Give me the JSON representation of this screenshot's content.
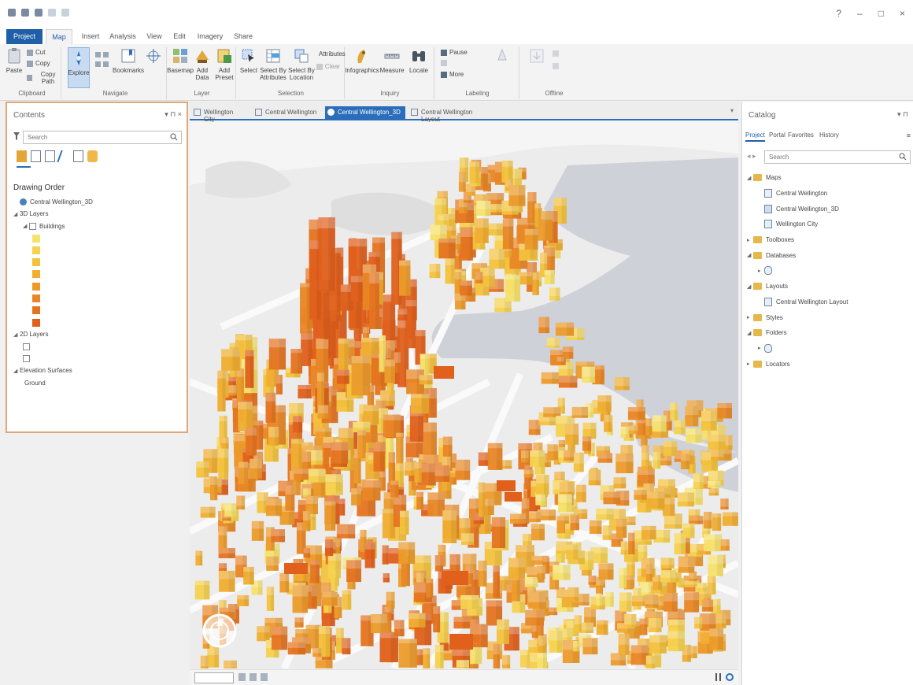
{
  "window": {},
  "ribbon_tabs": [
    {
      "label": "Project"
    },
    {
      "label": "Map"
    },
    {
      "label": "Insert"
    },
    {
      "label": "Analysis"
    },
    {
      "label": "View"
    },
    {
      "label": "Edit"
    },
    {
      "label": "Imagery"
    },
    {
      "label": "Share"
    }
  ],
  "ribbon": {
    "groups": [
      {
        "label": "Clipboard",
        "buttons": [
          {
            "label": "Paste"
          },
          {
            "label": "Cut"
          },
          {
            "label": "Copy"
          },
          {
            "label": "Copy Path"
          }
        ]
      },
      {
        "label": "Navigate",
        "buttons": [
          {
            "label": "Explore"
          },
          {
            "label": "Bookmarks"
          }
        ]
      },
      {
        "label": "Layer",
        "buttons": [
          {
            "label": "Basemap"
          },
          {
            "label": "Add Data"
          },
          {
            "label": "Add Preset"
          }
        ]
      },
      {
        "label": "Selection",
        "buttons": [
          {
            "label": "Select"
          },
          {
            "label": "Select By Attributes"
          },
          {
            "label": "Select By Location"
          },
          {
            "label": "Attributes"
          },
          {
            "label": "Clear"
          }
        ]
      },
      {
        "label": "Inquiry",
        "buttons": [
          {
            "label": "Infographics"
          },
          {
            "label": "Measure"
          },
          {
            "label": "Locate"
          }
        ]
      },
      {
        "label": "Labeling",
        "buttons": [
          {
            "label": "Pause"
          },
          {
            "label": "More"
          }
        ]
      },
      {
        "label": "Offline",
        "buttons": []
      }
    ]
  },
  "contents_pane": {
    "title": "Contents",
    "search_placeholder": "Search",
    "tree": [
      {
        "label": "Drawing Order",
        "kind": "header"
      },
      {
        "label": "Central Wellington_3D",
        "kind": "scene",
        "indent": 0
      },
      {
        "label": "3D Layers",
        "kind": "group",
        "indent": 0
      },
      {
        "label": "Buildings",
        "kind": "layer",
        "indent": 1
      },
      {
        "label": "",
        "kind": "swatch",
        "indent": 2,
        "color": "#f7e26b"
      },
      {
        "label": "",
        "kind": "swatch",
        "indent": 2,
        "color": "#f5d24f"
      },
      {
        "label": "",
        "kind": "swatch",
        "indent": 2,
        "color": "#f3c23d"
      },
      {
        "label": "",
        "kind": "swatch",
        "indent": 2,
        "color": "#f0ae32"
      },
      {
        "label": "",
        "kind": "swatch",
        "indent": 2,
        "color": "#ec9b2b"
      },
      {
        "label": "",
        "kind": "swatch",
        "indent": 2,
        "color": "#e98726"
      },
      {
        "label": "",
        "kind": "swatch",
        "indent": 2,
        "color": "#e57421"
      },
      {
        "label": "",
        "kind": "swatch",
        "indent": 2,
        "color": "#e0601c"
      },
      {
        "label": "2D Layers",
        "kind": "group",
        "indent": 0
      },
      {
        "label": "",
        "kind": "layer",
        "indent": 1
      },
      {
        "label": "",
        "kind": "layer",
        "indent": 1
      },
      {
        "label": "Elevation Surfaces",
        "kind": "group",
        "indent": 0
      },
      {
        "label": "Ground",
        "kind": "plain",
        "indent": 1
      }
    ]
  },
  "map_view": {
    "tabs": [
      {
        "label": "Wellington City",
        "active": false
      },
      {
        "label": "Central Wellington",
        "active": false
      },
      {
        "label": "Central Wellington_3D",
        "active": true
      },
      {
        "label": "Central Wellington Layout",
        "active": false
      }
    ],
    "scale": "",
    "colors": {
      "water": "#cfd1d9",
      "land": "#ececec",
      "roads": "#fafafa",
      "building_ramp": [
        "#f7e26b",
        "#f5d24f",
        "#f3c23d",
        "#f0ae32",
        "#ec9b2b",
        "#e98726",
        "#e57421",
        "#e0601c"
      ]
    }
  },
  "catalog_pane": {
    "title": "Catalog",
    "tabs": [
      {
        "label": "Project",
        "active": true
      },
      {
        "label": "Portal"
      },
      {
        "label": "Favorites"
      },
      {
        "label": "History"
      }
    ],
    "search_placeholder": "Search",
    "tree": [
      {
        "label": "Maps",
        "icon": "folder",
        "indent": 0
      },
      {
        "label": "Central Wellington",
        "icon": "map",
        "indent": 1
      },
      {
        "label": "Central Wellington_3D",
        "icon": "scene",
        "indent": 1
      },
      {
        "label": "Wellington City",
        "icon": "map",
        "indent": 1
      },
      {
        "label": "Toolboxes",
        "icon": "folder",
        "indent": 0
      },
      {
        "label": "Databases",
        "icon": "folder",
        "indent": 0
      },
      {
        "label": "",
        "icon": "db",
        "indent": 1
      },
      {
        "label": "Layouts",
        "icon": "folder",
        "indent": 0
      },
      {
        "label": "Central Wellington Layout",
        "icon": "map",
        "indent": 1
      },
      {
        "label": "Styles",
        "icon": "folder",
        "indent": 0
      },
      {
        "label": "Folders",
        "icon": "folder",
        "indent": 0
      },
      {
        "label": "",
        "icon": "db",
        "indent": 1
      },
      {
        "label": "Locators",
        "icon": "folder",
        "indent": 0
      }
    ]
  }
}
